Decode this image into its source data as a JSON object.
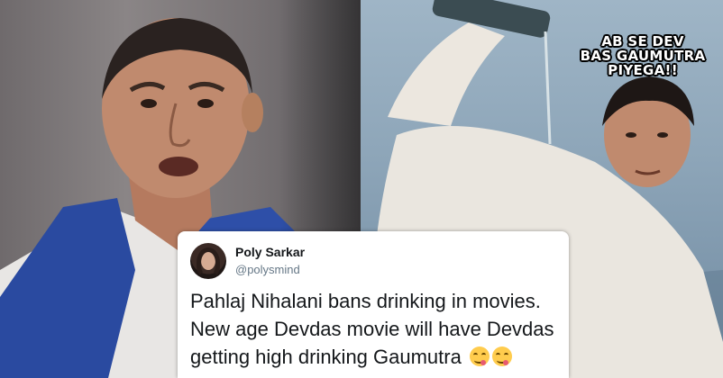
{
  "left_photo": {
    "subject": "man in blue vest speaking"
  },
  "right_photo": {
    "subject": "man in white shirt standing in water holding bottle"
  },
  "meme_caption": {
    "line1": "AB SE DEV",
    "line2": "BAS GAUMUTRA",
    "line3": "PIYEGA!!"
  },
  "tweet": {
    "name": "Poly Sarkar",
    "handle": "@polysmind",
    "lines": [
      "Pahlaj Nihalani bans drinking in movies.",
      "New age Devdas movie will have Devdas",
      "getting high drinking Gaumutra"
    ],
    "emoji_count": 2
  },
  "colors": {
    "tweet_text": "#14171a",
    "handle": "#657786",
    "caption": "#ffffff"
  }
}
